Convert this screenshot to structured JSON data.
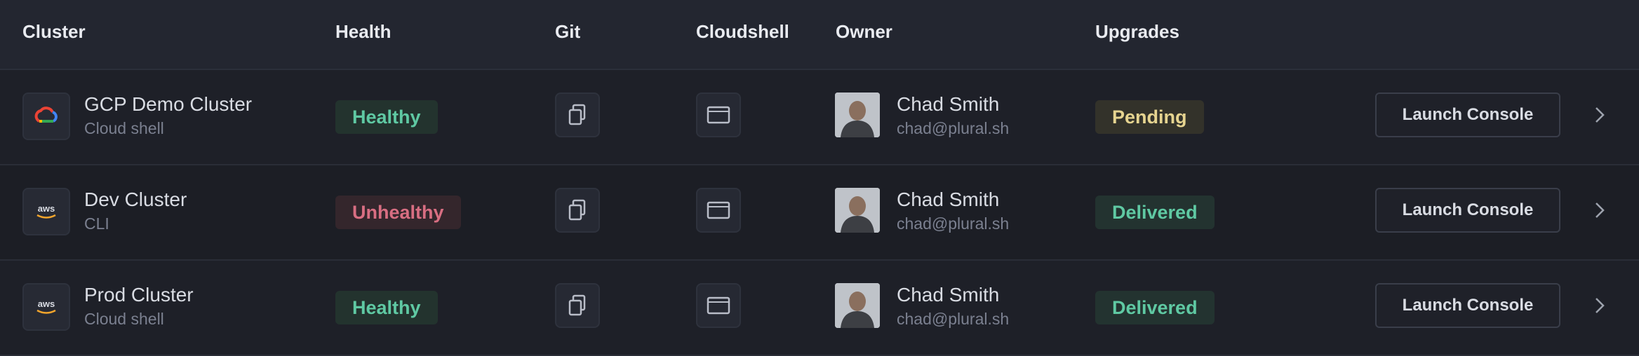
{
  "header": {
    "cluster": "Cluster",
    "health": "Health",
    "git": "Git",
    "cloudshell": "Cloudshell",
    "owner": "Owner",
    "upgrades": "Upgrades"
  },
  "rows": [
    {
      "provider_icon": "gcp-icon",
      "name": "GCP Demo Cluster",
      "sub": "Cloud shell",
      "health": "Healthy",
      "owner_name": "Chad Smith",
      "owner_email": "chad@plural.sh",
      "upgrade": "Pending",
      "launch_label": "Launch Console"
    },
    {
      "provider_icon": "aws-icon",
      "provider_text": "aws",
      "name": "Dev Cluster",
      "sub": "CLI",
      "health": "Unhealthy",
      "owner_name": "Chad Smith",
      "owner_email": "chad@plural.sh",
      "upgrade": "Delivered",
      "launch_label": "Launch Console"
    },
    {
      "provider_icon": "aws-icon",
      "provider_text": "aws",
      "name": "Prod Cluster",
      "sub": "Cloud shell",
      "health": "Healthy",
      "owner_name": "Chad Smith",
      "owner_email": "chad@plural.sh",
      "upgrade": "Delivered",
      "launch_label": "Launch Console"
    }
  ],
  "colors": {
    "healthy": "#5fc9a3",
    "unhealthy": "#d86e82",
    "pending": "#e6d490",
    "delivered": "#5fc9a3"
  }
}
